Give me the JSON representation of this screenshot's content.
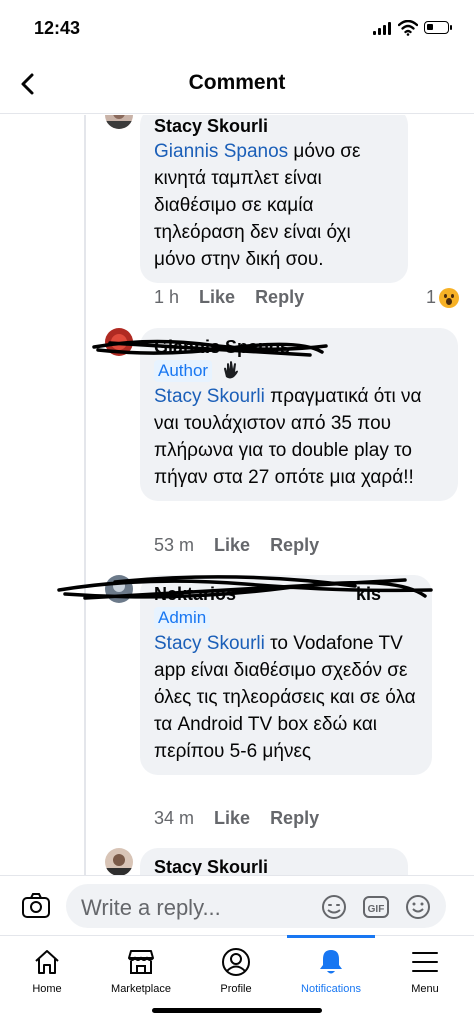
{
  "status_bar": {
    "time": "12:43",
    "battery_level": 0.35
  },
  "header": {
    "title": "Comment"
  },
  "comments": [
    {
      "author": "Stacy Skourli",
      "mention": "Giannis Spanos",
      "text": " μόνο σε κινητά ταμπλετ είναι διαθέσιμο σε καμία τηλεόραση δεν είναι όχι μόνο στην δική σου.",
      "time": "1 h",
      "like_label": "Like",
      "reply_label": "Reply",
      "reaction_count": "1",
      "reaction_icon": "wow-emoji-icon"
    },
    {
      "author": "Giannis Spanos",
      "badge": "Author",
      "badge_icon": "wave-hand-icon",
      "mention": "Stacy Skourli",
      "text": " πραγματικά ότι να ναι τουλάχιστον από 35 που πλήρωνα για το double play το πήγαν στα 27 οπότε μια χαρά!!",
      "time": "53 m",
      "like_label": "Like",
      "reply_label": "Reply"
    },
    {
      "author": "Nektarios",
      "author_tail": "kis",
      "badge": "Admin",
      "mention": "Stacy Skourli",
      "text": " το Vodafone TV app είναι διαθέσιμο σχεδόν σε όλες τις τηλεοράσεις και σε όλα τα Android TV box εδώ και περίπου 5-6 μήνες",
      "time": "34 m",
      "like_label": "Like",
      "reply_label": "Reply"
    },
    {
      "author": "Stacy Skourli"
    }
  ],
  "reply_bar": {
    "placeholder": "Write a reply...",
    "icons": [
      "camera-icon",
      "sticker-icon",
      "gif-icon",
      "emoji-icon"
    ]
  },
  "tab_bar": {
    "active": "Notifications",
    "accent_color": "#1877f2",
    "tabs": [
      {
        "label": "Home",
        "icon": "home-icon"
      },
      {
        "label": "Marketplace",
        "icon": "marketplace-icon"
      },
      {
        "label": "Profile",
        "icon": "profile-icon"
      },
      {
        "label": "Notifications",
        "icon": "bell-icon"
      },
      {
        "label": "Menu",
        "icon": "menu-icon"
      }
    ]
  }
}
